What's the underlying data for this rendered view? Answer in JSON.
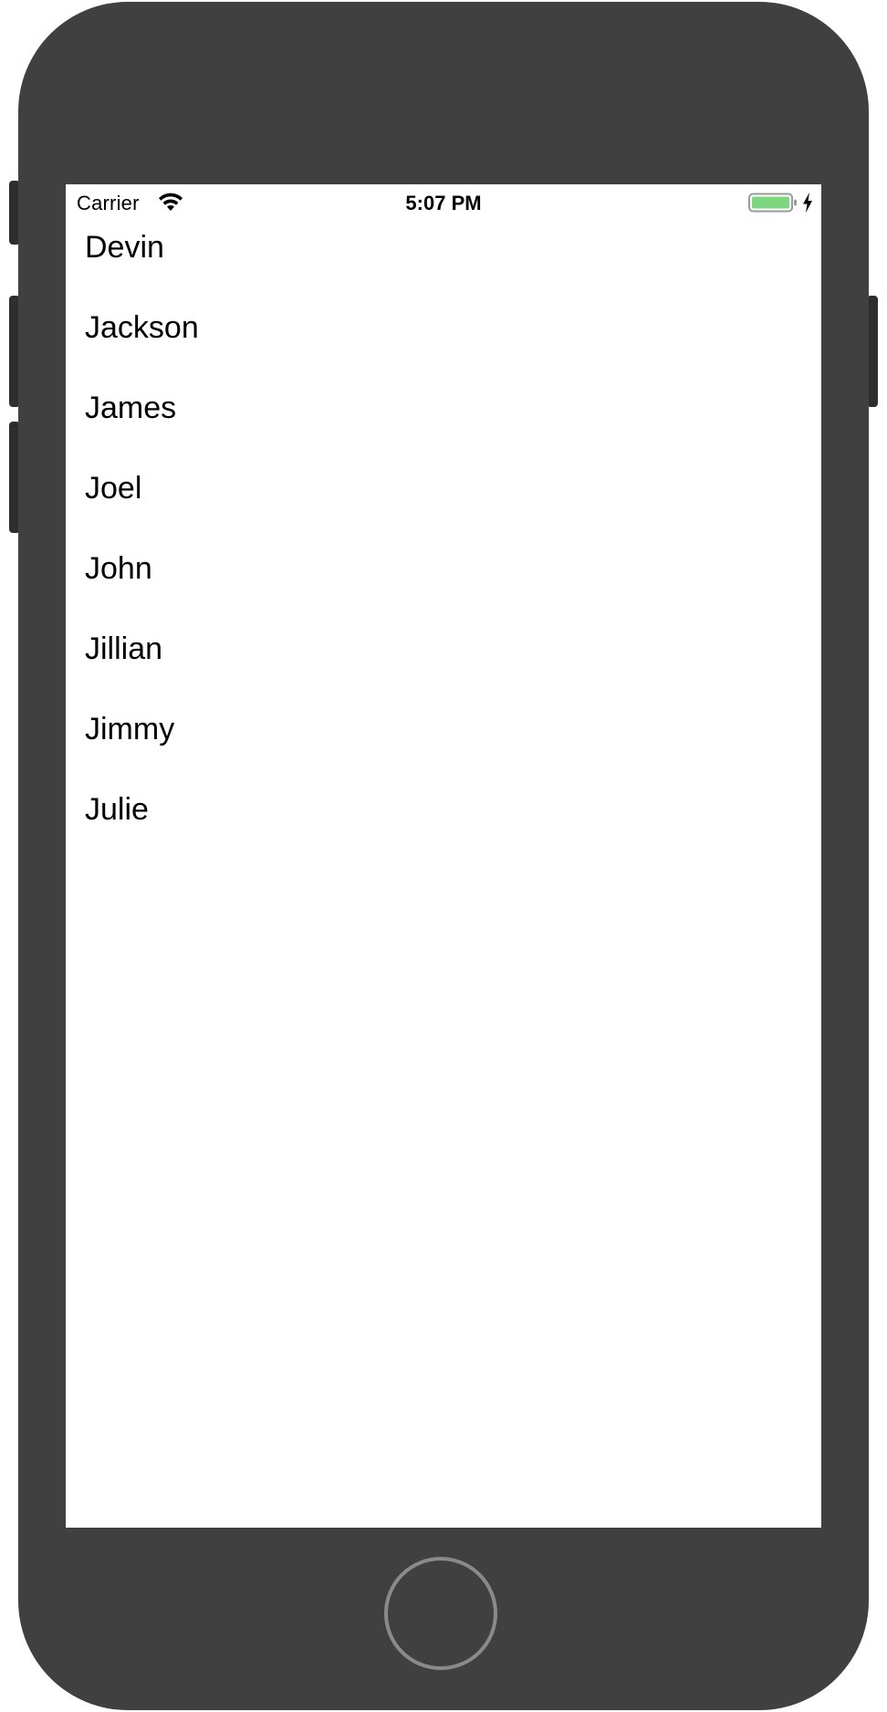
{
  "status_bar": {
    "carrier": "Carrier",
    "time": "5:07 PM",
    "wifi_icon": "wifi-icon",
    "battery_icon": "battery-icon",
    "charging_icon": "charging-bolt-icon",
    "battery_color": "#7ed67f"
  },
  "names": [
    "Devin",
    "Jackson",
    "James",
    "Joel",
    "John",
    "Jillian",
    "Jimmy",
    "Julie"
  ],
  "device": {
    "frame_color": "#404040",
    "home_button_icon": "home-button"
  }
}
